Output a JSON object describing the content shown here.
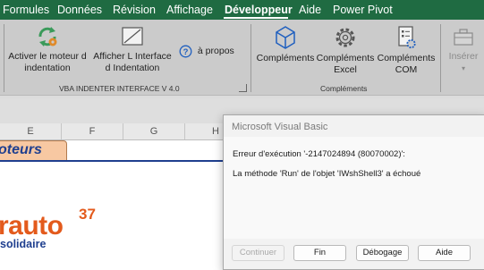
{
  "ribbon_tabs": [
    "Formules",
    "Données",
    "Révision",
    "Affichage",
    "Développeur",
    "Aide",
    "Power Pivot"
  ],
  "active_tab": "Développeur",
  "ribbon": {
    "indenter_group": {
      "label": "VBA INDENTER INTERFACE  V 4.0",
      "btn_activate": "Activer le moteur d indentation",
      "btn_show": "Afficher L Interface d Indentation",
      "btn_about": "à propos"
    },
    "complements_group": {
      "label": "Compléments",
      "btn_complements": "Compléments",
      "btn_excel": "Compléments Excel",
      "btn_com": "Compléments COM"
    },
    "insert_label": "Insérer"
  },
  "columns": [
    "E",
    "F",
    "G",
    "H"
  ],
  "sheet": {
    "tab_text": "oteurs",
    "logo_main": "rauto",
    "logo_sup": "37",
    "logo_sub": "solidaire"
  },
  "dialog": {
    "title": "Microsoft Visual Basic",
    "error": "Erreur d'exécution '-2147024894 (80070002)':",
    "message": "La méthode 'Run' de l'objet 'IWshShell3' a échoué",
    "buttons": {
      "continue": "Continuer",
      "end": "Fin",
      "debug": "Débogage",
      "help": "Aide"
    }
  },
  "colors": {
    "ribbon_tab_bar": "#1f6b42",
    "ribbon_body": "#cbcbcb",
    "brand_orange": "#e35a1c",
    "brand_blue": "#1f3f8f"
  }
}
